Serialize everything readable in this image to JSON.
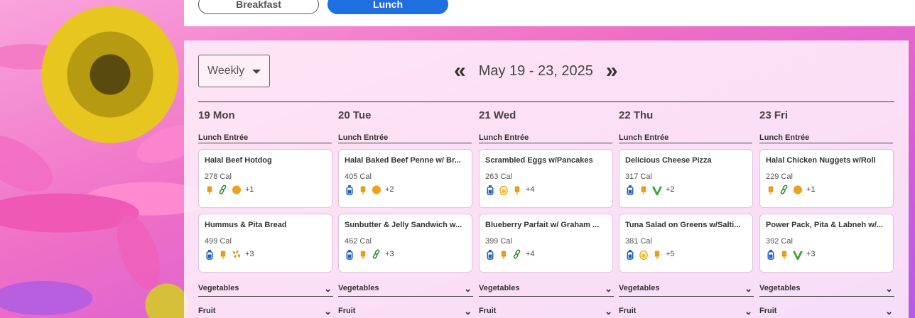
{
  "meals": {
    "breakfast_label": "Breakfast",
    "lunch_label": "Lunch",
    "active": "Lunch"
  },
  "view": {
    "selected": "Weekly"
  },
  "date_nav": {
    "range": "May 19 - 23, 2025",
    "prev_icon": "double-chevron-left-icon",
    "next_icon": "double-chevron-right-icon"
  },
  "days": [
    {
      "title": "19 Mon",
      "category": "Lunch Entrée",
      "items": [
        {
          "name": "Halal Beef Hotdog",
          "cal": "278 Cal",
          "icons": [
            "wheat",
            "chain",
            "dot"
          ],
          "more": "+1"
        },
        {
          "name": "Hummus & Pita Bread",
          "cal": "499 Cal",
          "icons": [
            "bottle",
            "wheat",
            "sesame"
          ],
          "more": "+3"
        }
      ],
      "vegetables": "Vegetables",
      "fruit": "Fruit"
    },
    {
      "title": "20 Tue",
      "category": "Lunch Entrée",
      "items": [
        {
          "name": "Halal Baked Beef Penne w/ Br...",
          "cal": "405 Cal",
          "icons": [
            "bottle",
            "wheat",
            "dot"
          ],
          "more": "+2"
        },
        {
          "name": "Sunbutter & Jelly Sandwich w...",
          "cal": "462 Cal",
          "icons": [
            "bottle",
            "wheat",
            "chain"
          ],
          "more": "+3"
        }
      ],
      "vegetables": "Vegetables",
      "fruit": "Fruit"
    },
    {
      "title": "21 Wed",
      "category": "Lunch Entrée",
      "items": [
        {
          "name": "Scrambled Eggs w/Pancakes",
          "cal": "263 Cal",
          "icons": [
            "bottle",
            "egg",
            "wheat"
          ],
          "more": "+4"
        },
        {
          "name": "Blueberry Parfait w/ Graham ...",
          "cal": "399 Cal",
          "icons": [
            "bottle",
            "wheat",
            "chain"
          ],
          "more": "+4"
        }
      ],
      "vegetables": "Vegetables",
      "fruit": "Fruit"
    },
    {
      "title": "22 Thu",
      "category": "Lunch Entrée",
      "items": [
        {
          "name": "Delicious Cheese Pizza",
          "cal": "317 Cal",
          "icons": [
            "bottle",
            "wheat",
            "vegan"
          ],
          "more": "+2"
        },
        {
          "name": "Tuna Salad on Greens w/Salti...",
          "cal": "381 Cal",
          "icons": [
            "bottle",
            "egg",
            "wheat"
          ],
          "more": "+5"
        }
      ],
      "vegetables": "Vegetables",
      "fruit": "Fruit"
    },
    {
      "title": "23 Fri",
      "category": "Lunch Entrée",
      "items": [
        {
          "name": "Halal Chicken Nuggets w/Roll",
          "cal": "229 Cal",
          "icons": [
            "wheat",
            "chain",
            "dot"
          ],
          "more": "+1"
        },
        {
          "name": "Power Pack, Pita & Labneh w/...",
          "cal": "392 Cal",
          "icons": [
            "bottle",
            "wheat",
            "vegan"
          ],
          "more": "+3"
        }
      ],
      "vegetables": "Vegetables",
      "fruit": "Fruit"
    }
  ],
  "colors": {
    "accent": "#1f6fe0",
    "wheat": "#e59a1c",
    "chain": "#2e8b2e",
    "bottle": "#1f5fc0",
    "vegan": "#3aa63a",
    "dot": "#f0a020"
  }
}
